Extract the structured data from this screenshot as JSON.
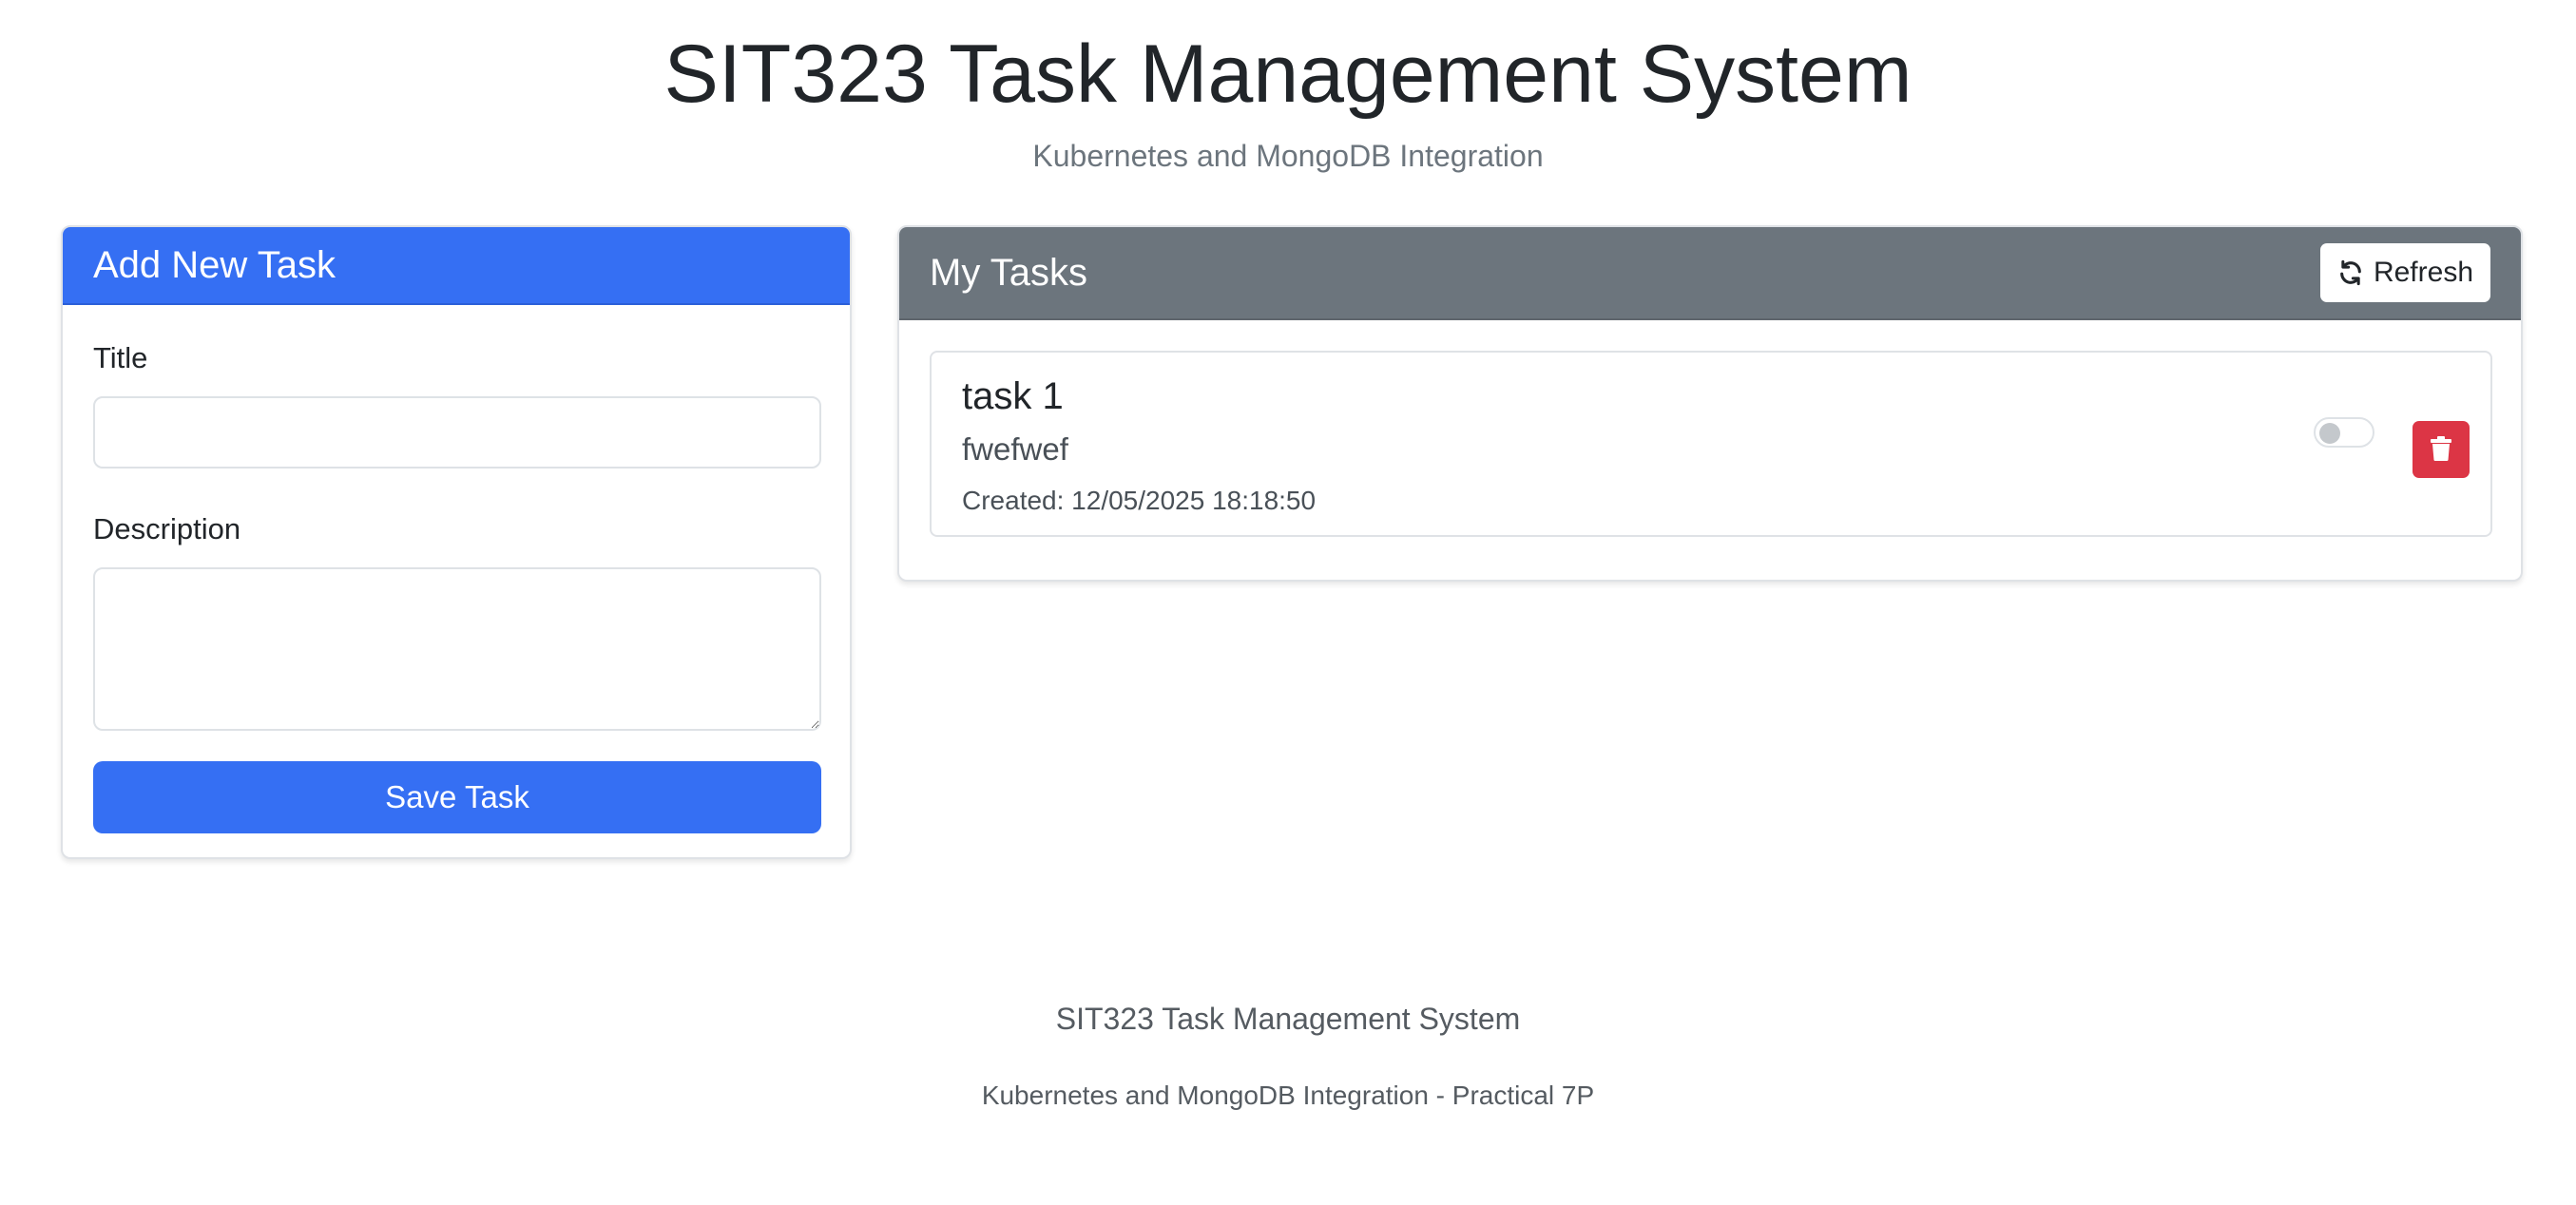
{
  "header": {
    "title": "SIT323 Task Management System",
    "subtitle": "Kubernetes and MongoDB Integration"
  },
  "add_task": {
    "heading": "Add New Task",
    "title_label": "Title",
    "title_value": "",
    "description_label": "Description",
    "description_value": "",
    "save_label": "Save Task"
  },
  "tasks_panel": {
    "heading": "My Tasks",
    "refresh_label": "Refresh",
    "refresh_icon": "sync-icon",
    "tasks": [
      {
        "title": "task 1",
        "description": "fwefwef",
        "created": "Created: 12/05/2025 18:18:50",
        "completed": false,
        "delete_icon": "trash-icon"
      }
    ]
  },
  "footer": {
    "title": "SIT323 Task Management System",
    "subtitle": "Kubernetes and MongoDB Integration - Practical 7P"
  },
  "colors": {
    "primary": "#356ff3",
    "secondary": "#6c757d",
    "danger": "#dc3545"
  }
}
